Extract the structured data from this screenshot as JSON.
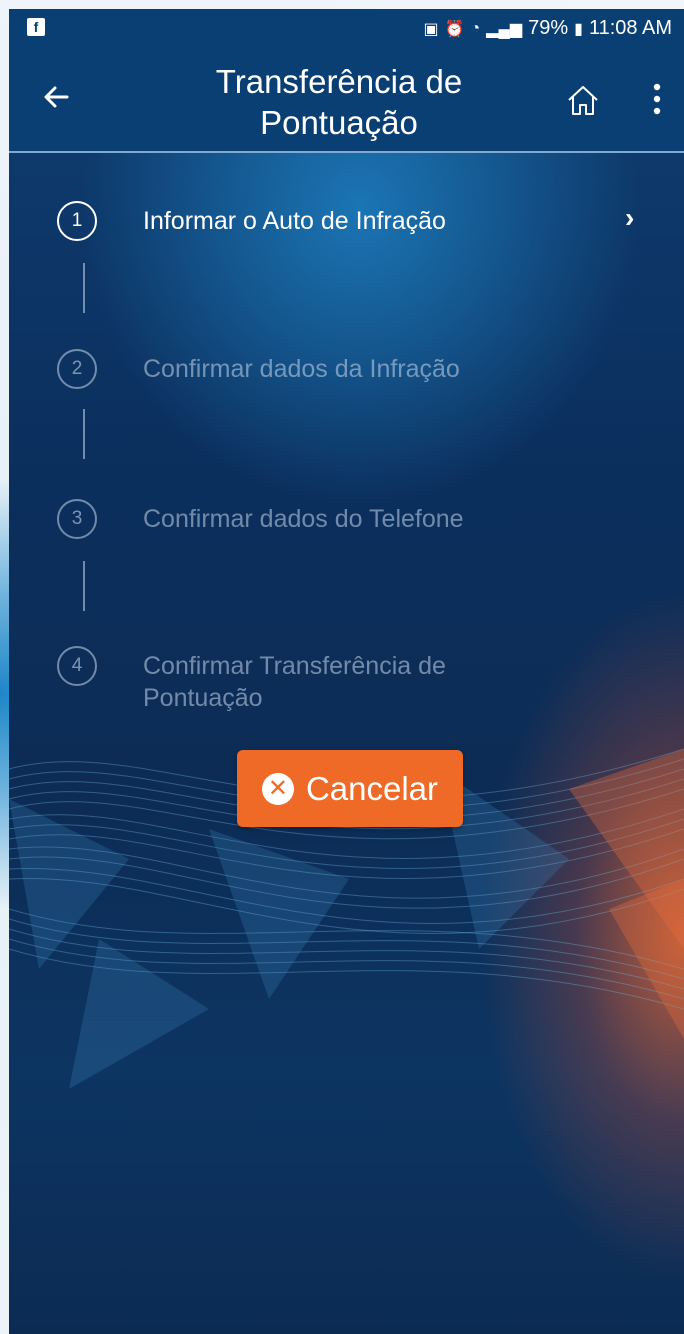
{
  "status_bar": {
    "app_badge": "f",
    "battery": "79%",
    "time": "11:08 AM"
  },
  "app_bar": {
    "title": "Transferência de Pontuação"
  },
  "steps": [
    {
      "number": "1",
      "label": "Informar o Auto de Infração",
      "active": true
    },
    {
      "number": "2",
      "label": "Confirmar dados da Infração",
      "active": false
    },
    {
      "number": "3",
      "label": "Confirmar dados do Telefone",
      "active": false
    },
    {
      "number": "4",
      "label": "Confirmar Transferência de Pontuação",
      "active": false
    }
  ],
  "cancel_button": {
    "label": "Cancelar"
  },
  "colors": {
    "app_bar": "#0a3f73",
    "accent_button": "#ef6a26",
    "dim_text": "#c8d7eb"
  },
  "icons": {
    "back": "arrow-left-icon",
    "home": "home-icon",
    "more": "more-vertical-icon",
    "chevron": "chevron-right-icon",
    "cancel": "close-circle-icon"
  }
}
